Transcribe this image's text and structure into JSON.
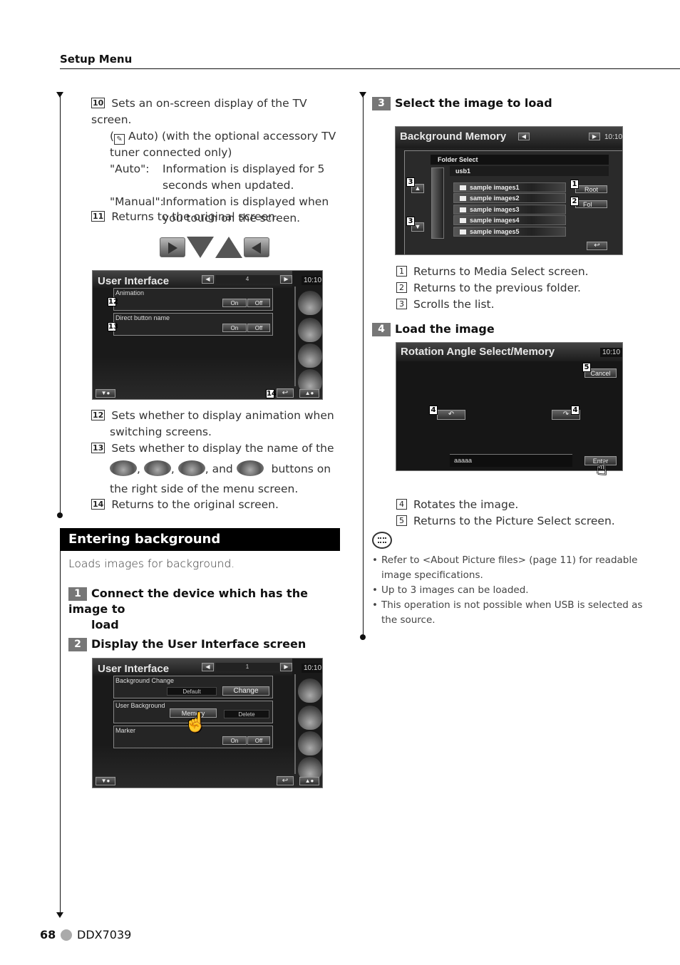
{
  "header": {
    "title": "Setup Menu"
  },
  "left_column": {
    "item10": {
      "num": "10",
      "text": "Sets an on-screen display of the TV screen.",
      "line2": " Auto) (with the optional accessory TV",
      "line3": "tuner connected only)",
      "auto_label": "\"Auto\":",
      "auto_text1": "Information is displayed for 5",
      "auto_text2": "seconds when updated.",
      "manual_label": "\"Manual\":",
      "manual_text1": "Information is displayed when",
      "manual_text2": "you touch on the screen."
    },
    "item11": {
      "num": "11",
      "text": "Returns to the original screen."
    },
    "nav_icons": [
      "play-right-icon",
      "triangle-down-icon",
      "triangle-up-icon",
      "play-left-icon"
    ],
    "screen_ui4": {
      "title": "User Interface",
      "page": "4",
      "clock": "10:10",
      "rows": [
        {
          "label": "Animation",
          "callout": "12",
          "on": "On",
          "off": "Off"
        },
        {
          "label": "Direct button name",
          "callout": "13",
          "on": "On",
          "off": "Off"
        }
      ],
      "return_callout": "14"
    },
    "item12": {
      "num": "12",
      "text1": "Sets whether to display animation when",
      "text2": "switching screens."
    },
    "item13": {
      "num": "13",
      "text1": "Sets whether to display the name of the",
      "sep1": ",",
      "sep2": ",",
      "sep3": ", and",
      "text2": "buttons on",
      "text3": "the right side of the menu screen."
    },
    "item14": {
      "num": "14",
      "text": "Returns to the original screen."
    },
    "section": {
      "title": "Entering background",
      "intro": "Loads images for background."
    },
    "step1": {
      "num": "1",
      "text1": "Connect the device which has the image to",
      "text2": "load"
    },
    "step2": {
      "num": "2",
      "text": "Display the User Interface screen"
    },
    "screen_ui1": {
      "title": "User Interface",
      "page": "1",
      "clock": "10:10",
      "rows": [
        {
          "label": "Background Change",
          "btn1": "Default",
          "btn2": "Change"
        },
        {
          "label": "User Background",
          "btn1": "Memory",
          "btn2": "Delete"
        },
        {
          "label": "Marker",
          "on": "On",
          "off": "Off"
        }
      ]
    }
  },
  "right_column": {
    "step3": {
      "num": "3",
      "text": "Select the image to load"
    },
    "screen_bgmem": {
      "title": "Background Memory",
      "clock": "10:10",
      "folder_select_label": "Folder Select",
      "current_folder": "usb1",
      "folders": [
        "sample images1",
        "sample images2",
        "sample images3",
        "sample images4",
        "sample images5"
      ],
      "root_btn": "Root",
      "fol_btn": "Fol",
      "callouts": {
        "root": "1",
        "fol": "2",
        "up": "3",
        "down": "3"
      }
    },
    "items_step3": [
      {
        "num": "1",
        "text": "Returns to Media Select screen."
      },
      {
        "num": "2",
        "text": "Returns to the previous folder."
      },
      {
        "num": "3",
        "text": "Scrolls the list."
      }
    ],
    "step4": {
      "num": "4",
      "text": "Load the image"
    },
    "screen_rotation": {
      "title": "Rotation Angle Select/Memory",
      "clock": "10:10",
      "cancel_btn": "Cancel",
      "enter_btn": "Enter",
      "filename": "aaaaa",
      "callouts": {
        "cancel": "5",
        "rotate_left": "4",
        "rotate_right": "4"
      }
    },
    "items_step4": [
      {
        "num": "4",
        "text": "Rotates the image."
      },
      {
        "num": "5",
        "text": "Returns to the Picture Select screen."
      }
    ],
    "notes": [
      "Refer to <About Picture files> (page 11) for readable image specifications.",
      "Up to 3 images can be loaded.",
      "This operation is not possible when USB is selected as the source."
    ]
  },
  "footer": {
    "page": "68",
    "model": "DDX7039"
  }
}
